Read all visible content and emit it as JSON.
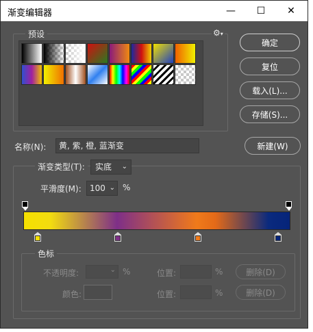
{
  "window": {
    "title": "渐变编辑器",
    "min": "—",
    "max": "☐",
    "close": "✕"
  },
  "presets": {
    "label": "预设",
    "gear": "⚙",
    "swatches": [
      "linear-gradient(to right,#000,#fff)",
      "checker-dark",
      "checker-white",
      "linear-gradient(135deg,#d01010,#2a7a20)",
      "linear-gradient(to right,#8a1a7a,#f08a10)",
      "linear-gradient(to right,#1a2aa0,#d01010,#f0d000)",
      "linear-gradient(135deg,#f0e000,#2040c0)",
      "linear-gradient(to right,#f06000,#f0f000)",
      "linear-gradient(to right,#3050d0,#a020a0,#f0c000)",
      "linear-gradient(to right,#f0f000,#f07000)",
      "linear-gradient(to right,#a05020,#fff,#a05020)",
      "linear-gradient(135deg,#fff,#3080f0,#fff)",
      "linear-gradient(to right,#f00,#ff0,#0f0,#0ff,#00f,#f0f,#f00)",
      "repeating-linear-gradient(135deg,#f00 0 4px,#ff0 4px 8px,#0f0 8px 12px,#00f 12px 16px)",
      "repeating-linear-gradient(135deg,#fff 0 4px,#000 4px 7px)",
      "checker-plain"
    ]
  },
  "buttons": {
    "ok": "确定",
    "reset": "复位",
    "load": "载入(L)...",
    "save": "存储(S)...",
    "new": "新建(W)"
  },
  "name": {
    "label": "名称(N):",
    "value": "黄, 紫, 橙, 蓝渐变"
  },
  "gradientType": {
    "label": "渐变类型(T):",
    "value": "实底"
  },
  "smoothness": {
    "label": "平滑度(M):",
    "value": "100",
    "unit": "%"
  },
  "stops": {
    "label": "色标",
    "opacityLabel": "不透明度:",
    "opacityUnit": "%",
    "locationLabel": "位置:",
    "locationUnit": "%",
    "deleteLabel": "删除(D)",
    "colorLabel": "颜色:",
    "location2Label": "位置:",
    "location2Unit": "%",
    "delete2Label": "删除(D)"
  },
  "colorStops": [
    "#f5e000",
    "#7e2f88",
    "#f07a1a",
    "#06247a"
  ],
  "colorStopPositions": [
    0.055,
    0.355,
    0.655,
    0.955
  ]
}
